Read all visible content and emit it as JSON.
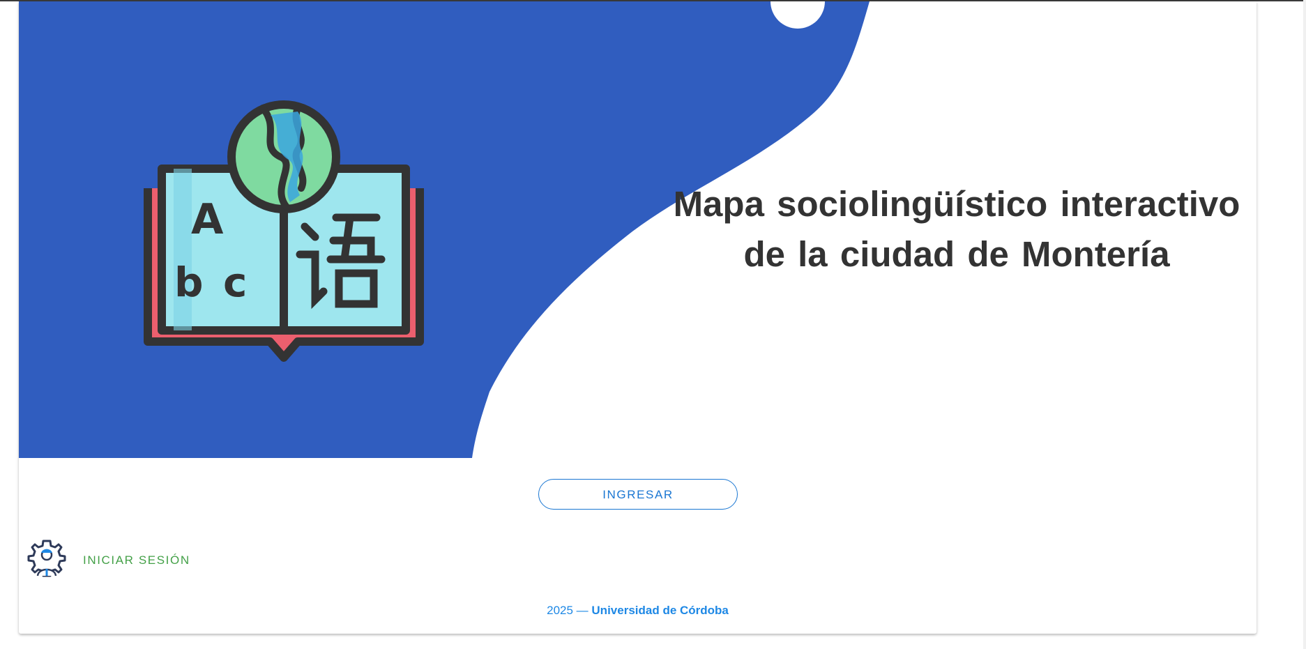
{
  "banner": {
    "title": "Mapa sociolingüístico interactivo de la ciudad de Montería",
    "icon": "open-book-globe-languages-icon",
    "colors": {
      "blue": "#305dbf",
      "white": "#ffffff"
    }
  },
  "actions": {
    "ingresar_label": "INGRESAR",
    "login_label": "INICIAR SESIÓN",
    "login_icon": "admin-gear-user-icon"
  },
  "footer": {
    "year": "2025",
    "separator": "—",
    "organization": "Universidad de Córdoba"
  },
  "colors": {
    "accent_blue": "#1976d2",
    "login_green": "#43a047",
    "footer_blue": "#1e88e5",
    "title_gray": "#333333"
  }
}
